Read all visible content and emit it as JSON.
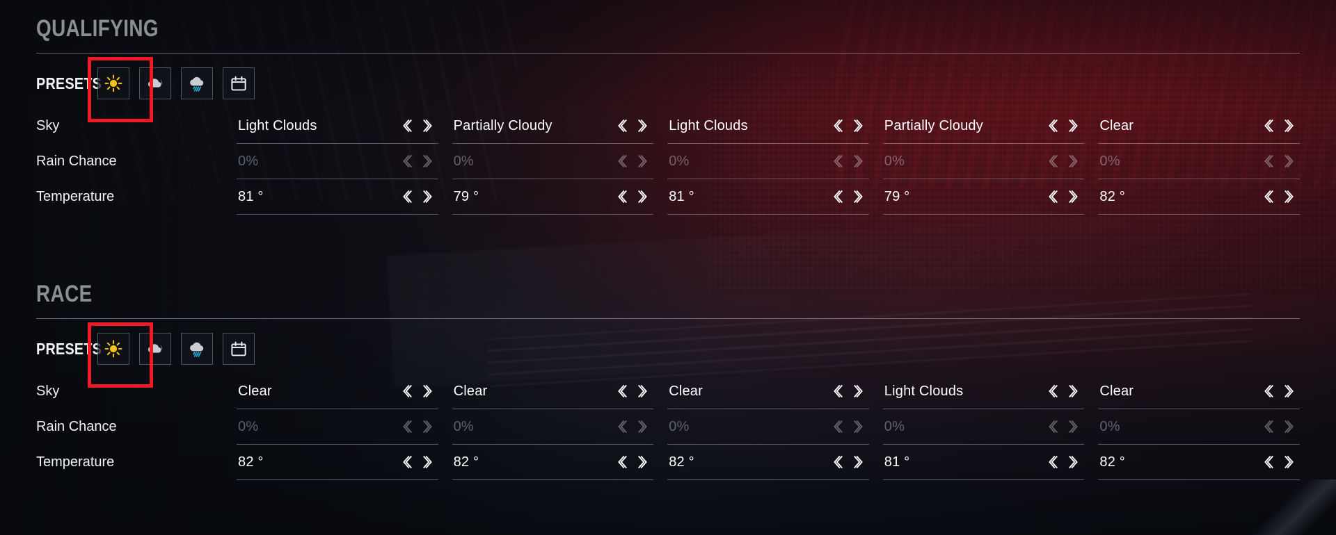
{
  "background": {
    "accent_red": "#96161f",
    "base_dark": "#0b0d12",
    "selection_red": "#ee1b24"
  },
  "sections": [
    {
      "id": "qualifying",
      "title": "QUALIFYING",
      "presets": {
        "label": "PRESETS",
        "selected_index": 0,
        "buttons": [
          {
            "icon": "sun-icon",
            "name": "preset-clear"
          },
          {
            "icon": "cloud-icon",
            "name": "preset-cloudy"
          },
          {
            "icon": "rain-cloud-icon",
            "name": "preset-rain"
          },
          {
            "icon": "calendar-icon",
            "name": "preset-custom"
          }
        ]
      },
      "rows": [
        {
          "label": "Sky",
          "dim": false,
          "values": [
            "Light Clouds",
            "Partially Cloudy",
            "Light Clouds",
            "Partially Cloudy",
            "Clear"
          ]
        },
        {
          "label": "Rain Chance",
          "dim": true,
          "values": [
            "0%",
            "0%",
            "0%",
            "0%",
            "0%"
          ]
        },
        {
          "label": "Temperature",
          "dim": false,
          "values": [
            "81 °",
            "79 °",
            "81 °",
            "79 °",
            "82 °"
          ]
        }
      ]
    },
    {
      "id": "race",
      "title": "RACE",
      "presets": {
        "label": "PRESETS",
        "selected_index": 0,
        "buttons": [
          {
            "icon": "sun-icon",
            "name": "preset-clear"
          },
          {
            "icon": "cloud-icon",
            "name": "preset-cloudy"
          },
          {
            "icon": "rain-cloud-icon",
            "name": "preset-rain"
          },
          {
            "icon": "calendar-icon",
            "name": "preset-custom"
          }
        ]
      },
      "rows": [
        {
          "label": "Sky",
          "dim": false,
          "values": [
            "Clear",
            "Clear",
            "Clear",
            "Light Clouds",
            "Clear"
          ]
        },
        {
          "label": "Rain Chance",
          "dim": true,
          "values": [
            "0%",
            "0%",
            "0%",
            "0%",
            "0%"
          ]
        },
        {
          "label": "Temperature",
          "dim": false,
          "values": [
            "82 °",
            "82 °",
            "82 °",
            "81 °",
            "82 °"
          ]
        }
      ]
    }
  ],
  "arrows": {
    "prev": "chevron-left-icon",
    "next": "chevron-right-icon"
  }
}
